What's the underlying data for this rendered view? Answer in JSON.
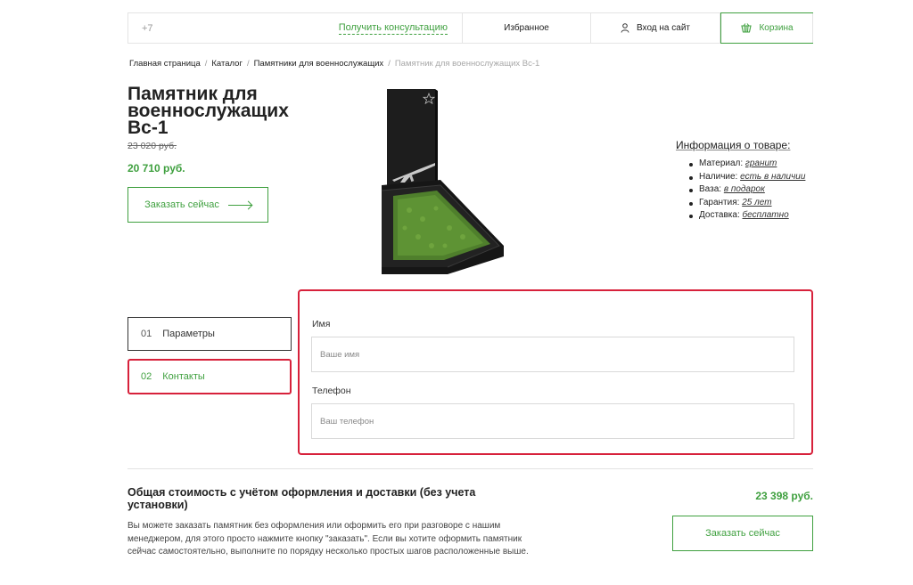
{
  "header": {
    "phone": "+7",
    "consult_link": "Получить консультацию",
    "favorites": "Избранное",
    "login": "Вход на сайт",
    "cart": "Корзина"
  },
  "breadcrumb": [
    "Главная страница",
    "Каталог",
    "Памятники для военнослужащих",
    "Памятник для военнослужащих Вс-1"
  ],
  "product": {
    "title": "Памятник для военнослужащих Вс-1",
    "old_price": "23 020 руб.",
    "new_price": "20 710 руб.",
    "order_button": "Заказать сейчас"
  },
  "info": {
    "title": "Информация о товаре:",
    "items": [
      {
        "label": "Материал:",
        "value": "гранит"
      },
      {
        "label": "Наличие:",
        "value": "есть в наличии"
      },
      {
        "label": "Ваза:",
        "value": "в подарок"
      },
      {
        "label": "Гарантия:",
        "value": "25 лет"
      },
      {
        "label": "Доставка:",
        "value": "бесплатно"
      }
    ]
  },
  "steps": [
    {
      "num": "01",
      "label": "Параметры"
    },
    {
      "num": "02",
      "label": "Контакты"
    }
  ],
  "form": {
    "name_label": "Имя",
    "name_placeholder": "Ваше имя",
    "phone_label": "Телефон",
    "phone_placeholder": "Ваш телефон"
  },
  "total": {
    "title": "Общая стоимость с учётом оформления и доставки (без учета установки)",
    "price": "23 398 руб.",
    "description": "Вы можете заказать памятник без оформления или оформить его при разговоре с нашим менеджером, для этого просто нажмите кнопку \"заказать\". Если вы хотите оформить памятник сейчас самостоятельно, выполните по порядку несколько простых шагов расположенные выше.",
    "order_button": "Заказать сейчас"
  },
  "colors": {
    "accent": "#3fa03f",
    "highlight": "#d7213b"
  }
}
